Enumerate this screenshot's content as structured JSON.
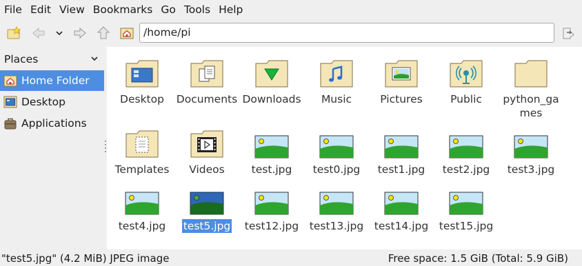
{
  "menu": [
    "File",
    "Edit",
    "View",
    "Bookmarks",
    "Go",
    "Tools",
    "Help"
  ],
  "toolbar": {
    "address": "/home/pi"
  },
  "sidebar": {
    "header": "Places",
    "items": [
      {
        "label": "Home Folder",
        "icon": "home-icon",
        "selected": true
      },
      {
        "label": "Desktop",
        "icon": "desktop-icon",
        "selected": false
      },
      {
        "label": "Applications",
        "icon": "applications-icon",
        "selected": false
      }
    ]
  },
  "files": [
    {
      "name": "Desktop",
      "kind": "folder-desktop"
    },
    {
      "name": "Documents",
      "kind": "folder-documents"
    },
    {
      "name": "Downloads",
      "kind": "folder-downloads"
    },
    {
      "name": "Music",
      "kind": "folder-music"
    },
    {
      "name": "Pictures",
      "kind": "folder-pictures"
    },
    {
      "name": "Public",
      "kind": "folder-public"
    },
    {
      "name": "python_games",
      "kind": "folder"
    },
    {
      "name": "Templates",
      "kind": "folder-templates"
    },
    {
      "name": "Videos",
      "kind": "folder-videos"
    },
    {
      "name": "test.jpg",
      "kind": "image"
    },
    {
      "name": "test0.jpg",
      "kind": "image"
    },
    {
      "name": "test1.jpg",
      "kind": "image"
    },
    {
      "name": "test2.jpg",
      "kind": "image"
    },
    {
      "name": "test3.jpg",
      "kind": "image"
    },
    {
      "name": "test4.jpg",
      "kind": "image"
    },
    {
      "name": "test5.jpg",
      "kind": "image",
      "selected": true
    },
    {
      "name": "test12.jpg",
      "kind": "image"
    },
    {
      "name": "test13.jpg",
      "kind": "image"
    },
    {
      "name": "test14.jpg",
      "kind": "image"
    },
    {
      "name": "test15.jpg",
      "kind": "image"
    }
  ],
  "status": {
    "left": "\"test5.jpg\" (4.2 MiB) JPEG image",
    "right": "Free space: 1.5 GiB (Total: 5.9 GiB)"
  },
  "colors": {
    "selection": "#4d8ee0",
    "folder": "#f5e6b8"
  }
}
